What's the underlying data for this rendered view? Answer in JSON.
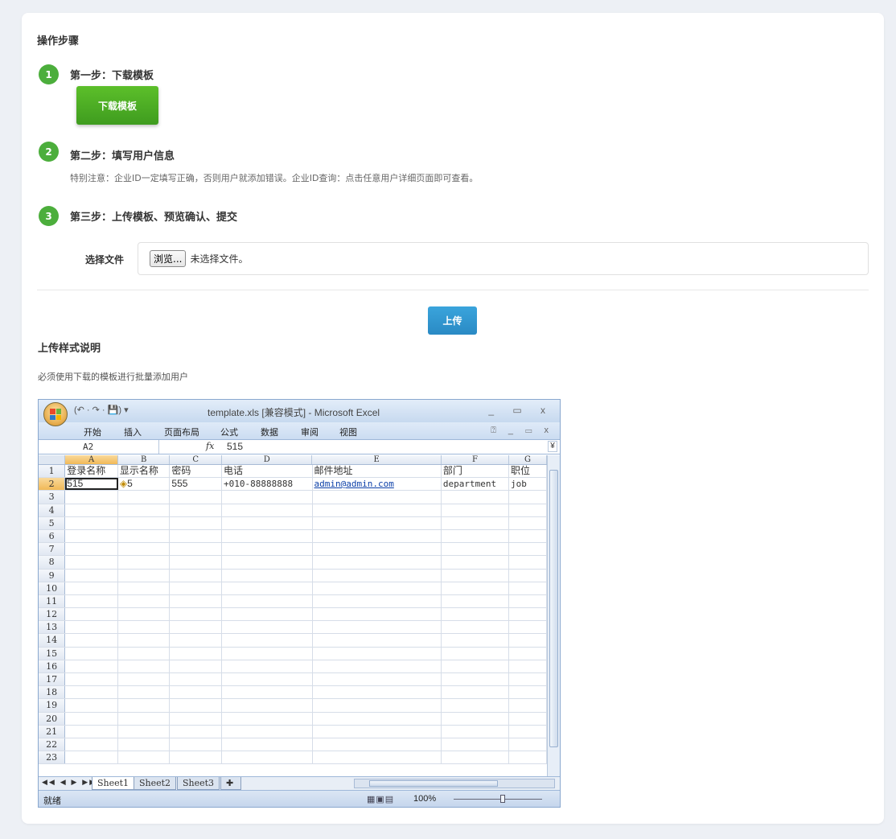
{
  "section_steps_title": "操作步骤",
  "steps": [
    {
      "num": "1",
      "title": "第一步：下载模板"
    },
    {
      "num": "2",
      "title": "第二步：填写用户信息"
    },
    {
      "num": "3",
      "title": "第三步：上传模板、预览确认、提交"
    }
  ],
  "download_button": "下载模板",
  "step2_note": "特别注意：企业ID一定填写正确，否则用户就添加错误。企业ID查询：点击任意用户详细页面即可查看。",
  "file": {
    "label": "选择文件",
    "browse": "浏览...",
    "status": "未选择文件。"
  },
  "upload_button": "上传",
  "section_format_title": "上传样式说明",
  "format_desc": "必须使用下载的模板进行批量添加用户",
  "excel": {
    "title": "template.xls  [兼容模式] - Microsoft Excel",
    "qat": "(↶ · ↷ · 💾) ▾",
    "window_controls": "_ ▭ x",
    "ribbon_tabs": [
      "开始",
      "插入",
      "页面布局",
      "公式",
      "数据",
      "审阅",
      "视图"
    ],
    "ribbon_right": "⍰ _ ▭ x",
    "name_box": "A2",
    "fx": "fx",
    "formula_value": "515",
    "columns": [
      "A",
      "B",
      "C",
      "D",
      "E",
      "F",
      "G"
    ],
    "header_row": [
      "登录名称",
      "显示名称",
      "密码",
      "电话",
      "邮件地址",
      "部门",
      "职位"
    ],
    "data_row": [
      "515",
      "5",
      "555",
      "+010-88888888",
      "admin@admin.com",
      "department",
      "job"
    ],
    "row_numbers": [
      "1",
      "2",
      "3",
      "4",
      "5",
      "6",
      "7",
      "8",
      "9",
      "10",
      "11",
      "12",
      "13",
      "14",
      "15",
      "16",
      "17",
      "18",
      "19",
      "20",
      "21",
      "22",
      "23"
    ],
    "sheet_nav": "◀◀ ◀ ▶ ▶▶",
    "sheets": [
      "Sheet1",
      "Sheet2",
      "Sheet3"
    ],
    "status_ready": "就绪",
    "zoom": "100%"
  }
}
